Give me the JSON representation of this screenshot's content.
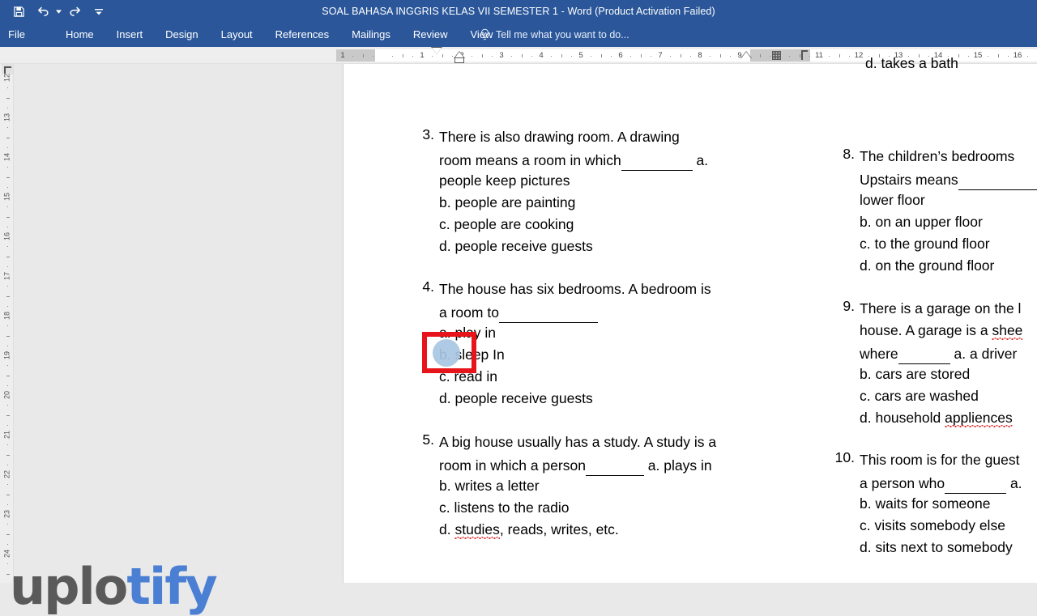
{
  "window": {
    "title": "SOAL BAHASA INGGRIS KELAS VII SEMESTER 1 - Word (Product Activation Failed)",
    "qat": [
      {
        "name": "save-icon",
        "label": "Save"
      },
      {
        "name": "undo-icon",
        "label": "Undo"
      },
      {
        "name": "redo-icon",
        "label": "Redo"
      },
      {
        "name": "customize-quick-access-toolbar-icon",
        "label": "Customize Quick Access Toolbar"
      }
    ]
  },
  "ribbon": {
    "tabs": [
      {
        "label": "File"
      },
      {
        "label": "Home"
      },
      {
        "label": "Insert"
      },
      {
        "label": "Design"
      },
      {
        "label": "Layout"
      },
      {
        "label": "References"
      },
      {
        "label": "Mailings"
      },
      {
        "label": "Review"
      },
      {
        "label": "View"
      }
    ],
    "tell_me": {
      "icon": "lightbulb-icon",
      "placeholder": "Tell me what you want to do..."
    }
  },
  "ruler": {
    "horizontal_marks": [
      "1",
      "1",
      "2",
      "3",
      "4",
      "5",
      "6",
      "7",
      "8",
      "9",
      "11",
      "12",
      "13",
      "14",
      "15",
      "16"
    ],
    "vertical_marks": [
      "12",
      "13",
      "14",
      "15",
      "16",
      "17",
      "18",
      "19",
      "20",
      "21",
      "22",
      "23",
      "24"
    ]
  },
  "document": {
    "column_left": {
      "questions": [
        {
          "number": "3.",
          "lines": [
            {
              "text": "There is also drawing room. A drawing"
            },
            {
              "pre": "room means a room in which",
              "blank": 88,
              "post": " a."
            },
            {
              "text": "people keep pictures"
            },
            {
              "text": "b. people are painting"
            },
            {
              "text": "c. people are cooking"
            },
            {
              "text": "d. people receive guests"
            }
          ]
        },
        {
          "number": "4.",
          "lines": [
            {
              "text": "The house has six bedrooms. A bedroom is"
            },
            {
              "pre": "a room to",
              "blank": 122,
              "post": ""
            },
            {
              "text": "a. play in"
            },
            {
              "text": "b. sleep In"
            },
            {
              "text": "c. read in"
            },
            {
              "text": "d. people receive guests"
            }
          ]
        },
        {
          "number": "5.",
          "lines": [
            {
              "text": "A big house usually has a study. A study is a"
            },
            {
              "pre": "room in which a person",
              "blank": 72,
              "post": " a. plays in"
            },
            {
              "text": "b. writes a letter"
            },
            {
              "text": "c. listens to the radio"
            },
            {
              "text": "d. studies, reads, writes, etc.",
              "misspelled": "studies"
            }
          ]
        }
      ]
    },
    "column_right": {
      "clipped_top_line": "d. takes a bath",
      "questions": [
        {
          "number": "8.",
          "lines": [
            {
              "text": "The children’s bedrooms"
            },
            {
              "pre": "Upstairs means",
              "blank": 110,
              "post": ""
            },
            {
              "text": "lower floor"
            },
            {
              "text": "b. on an upper floor"
            },
            {
              "text": "c. to the ground floor"
            },
            {
              "text": "d. on the ground floor"
            }
          ]
        },
        {
          "number": "9.",
          "lines": [
            {
              "text": "There is a garage on the l"
            },
            {
              "text": "house. A garage is a shee",
              "misspelled": "shee"
            },
            {
              "pre": "where",
              "blank": 64,
              "post": " a. a driver"
            },
            {
              "text": "b. cars are stored"
            },
            {
              "text": "c. cars are washed"
            },
            {
              "text": "d. household appliences ",
              "misspelled": "appliences"
            }
          ]
        },
        {
          "number": "10.",
          "lines": [
            {
              "text": "This room is for the guest"
            },
            {
              "pre": "a person who",
              "blank": 76,
              "post": " a."
            },
            {
              "text": "b. waits for someone"
            },
            {
              "text": "c. visits somebody else"
            },
            {
              "text": "d. sits next to somebody"
            }
          ]
        }
      ]
    }
  },
  "annotations": {
    "highlight_box": {
      "name": "red-highlight-box",
      "color": "#e8141b"
    },
    "circle_marker": {
      "name": "blue-circle-marker",
      "color": "#a8c6e3"
    }
  },
  "watermark": {
    "part1": "uplo",
    "part2": "tify",
    "color1": "#5a5a5a",
    "color2": "#4a7fd4"
  }
}
